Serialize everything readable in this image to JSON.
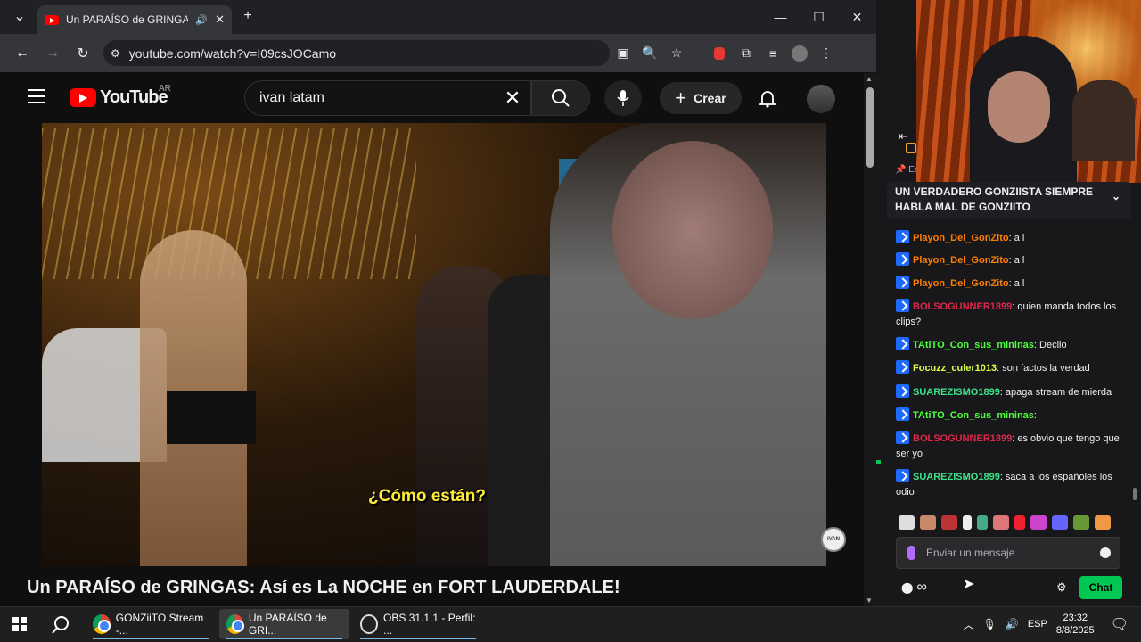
{
  "browser": {
    "tab_title": "Un PARAÍSO de GRINGAS: /",
    "url": "youtube.com/watch?v=I09csJOCamo"
  },
  "youtube": {
    "logo_text": "YouTube",
    "region": "AR",
    "search_value": "ivan latam",
    "create_label": "Crear",
    "video_title": "Un PARAÍSO de GRINGAS: Así es La NOCHE en FORT LAUDERDALE!",
    "caption": "¿Cómo están?",
    "watermark": "IVAN"
  },
  "chat": {
    "pinned_text": "UN VERDADERO GONZIISTA SIEMPRE HABLA MAL DE GONZIITO",
    "pinned_prefix": "En",
    "messages": [
      {
        "user": "Playon_Del_GonZito",
        "color": "#ff7f00",
        "text": ": a l"
      },
      {
        "user": "Playon_Del_GonZito",
        "color": "#ff7f00",
        "text": ": a l"
      },
      {
        "user": "Playon_Del_GonZito",
        "color": "#ff7f00",
        "text": ": a l"
      },
      {
        "user": "BOLSOGUNNER1899",
        "color": "#e0264a",
        "text": ": quien manda todos los clips?"
      },
      {
        "user": "TAtiTO_Con_sus_mininas",
        "color": "#4cff3a",
        "text": ": Decilo"
      },
      {
        "user": "Focuzz_culer1013",
        "color": "#d8ff4a",
        "text": ": son factos la verdad"
      },
      {
        "user": "SUAREZISMO1899",
        "color": "#3fe08a",
        "text": ": apaga stream de mierda"
      },
      {
        "user": "TAtiTO_Con_sus_mininas",
        "color": "#4cff3a",
        "text": ":"
      },
      {
        "user": "BOLSOGUNNER1899",
        "color": "#e0264a",
        "text": ": es obvio que tengo que ser yo"
      },
      {
        "user": "SUAREZISMO1899",
        "color": "#3fe08a",
        "text": ": saca a los españoles los odio"
      }
    ],
    "input_placeholder": "Enviar un mensaje",
    "chat_button": "Chat",
    "infinity": "∞"
  },
  "taskbar": {
    "items": [
      {
        "label": "GONZiiTO Stream -..."
      },
      {
        "label": "Un PARAÍSO de GRI..."
      },
      {
        "label": "OBS 31.1.1 - Perfil: ..."
      }
    ],
    "lang": "ESP",
    "time": "23:32",
    "date": "8/8/2025"
  },
  "icons": {
    "accent": "#ff0000",
    "chat_green": "#00c853"
  }
}
